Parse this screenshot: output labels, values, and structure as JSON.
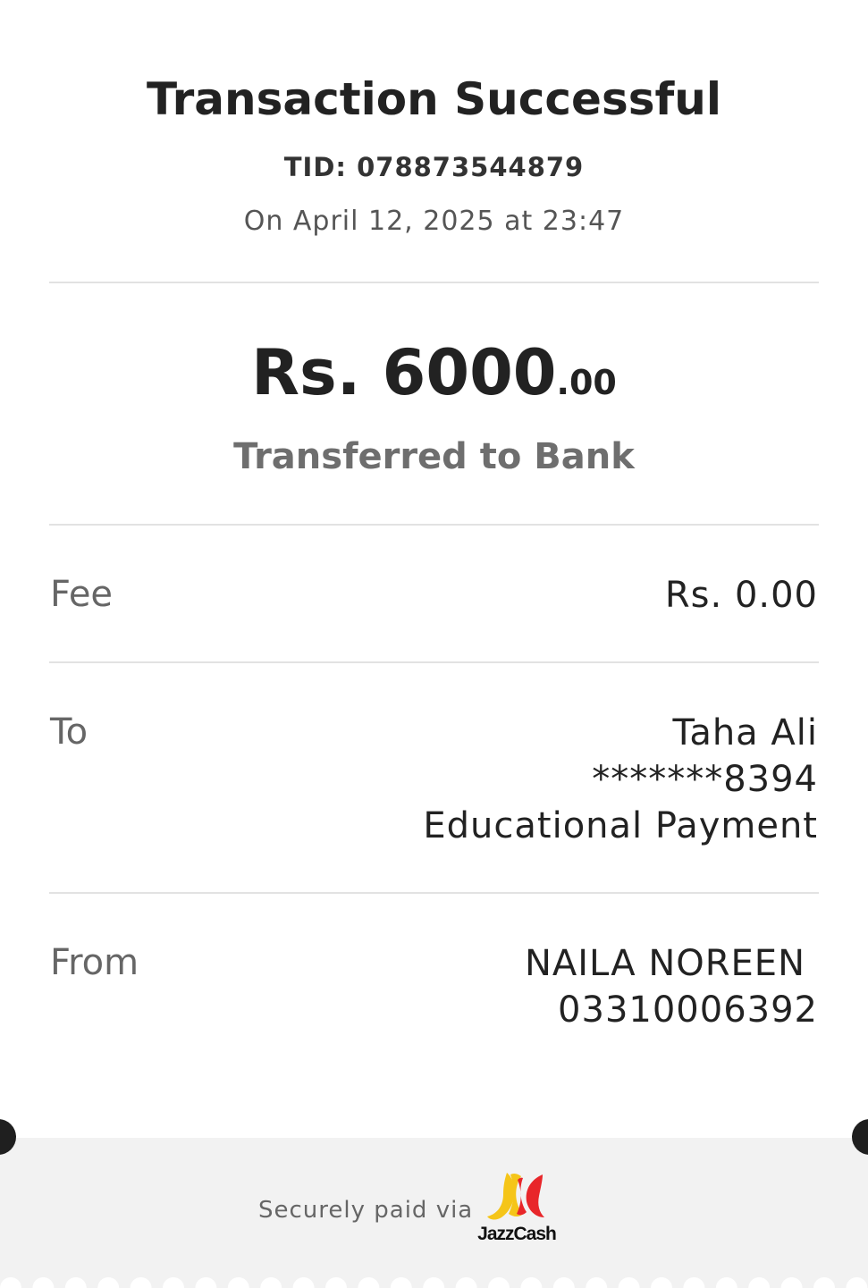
{
  "header": {
    "title": "Transaction Successful",
    "tid": "TID: 078873544879",
    "datetime": "On April 12, 2025 at 23:47"
  },
  "amount": {
    "main": "Rs. 6000",
    "cents": ".00",
    "caption": "Transferred to Bank"
  },
  "details": {
    "fee_label": "Fee",
    "fee_value": "Rs. 0.00",
    "to_label": "To",
    "to_name": "Taha Ali",
    "to_account": "*******8394",
    "to_purpose": "Educational Payment",
    "from_label": "From",
    "from_name": "NAILA NOREEN",
    "from_number": "03310006392"
  },
  "footer": {
    "secure_text": "Securely paid via",
    "logo_text": "JazzCash",
    "logo_icon": "jazzcash-logo-icon"
  },
  "colors": {
    "logo_yellow": "#f5c518",
    "logo_red": "#e8262a",
    "footer_bg": "#f2f2f2"
  }
}
